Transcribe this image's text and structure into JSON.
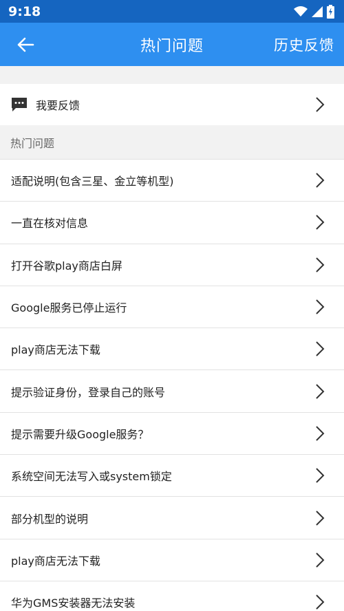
{
  "status_bar": {
    "time": "9:18",
    "icons": [
      "wifi-icon",
      "signal-icon",
      "battery-icon"
    ]
  },
  "app_bar": {
    "back_icon": "arrow-left-icon",
    "title": "热门问题",
    "history_label": "历史反馈"
  },
  "feedback": {
    "icon": "chat-bubble-icon",
    "label": "我要反馈"
  },
  "section": {
    "header": "热门问题"
  },
  "questions": [
    {
      "label": "适配说明(包含三星、金立等机型)"
    },
    {
      "label": "一直在核对信息"
    },
    {
      "label": "打开谷歌play商店白屏"
    },
    {
      "label": "Google服务已停止运行"
    },
    {
      "label": "play商店无法下载"
    },
    {
      "label": "提示验证身份，登录自己的账号"
    },
    {
      "label": "提示需要升级Google服务？"
    },
    {
      "label": "系统空间无法写入或system锁定"
    },
    {
      "label": "部分机型的说明"
    },
    {
      "label": "play商店无法下载"
    },
    {
      "label": "华为GMS安装器无法安装"
    }
  ],
  "colors": {
    "status_bar": "#1565c0",
    "app_bar": "#2e8ff0",
    "background": "#f2f2f2"
  }
}
